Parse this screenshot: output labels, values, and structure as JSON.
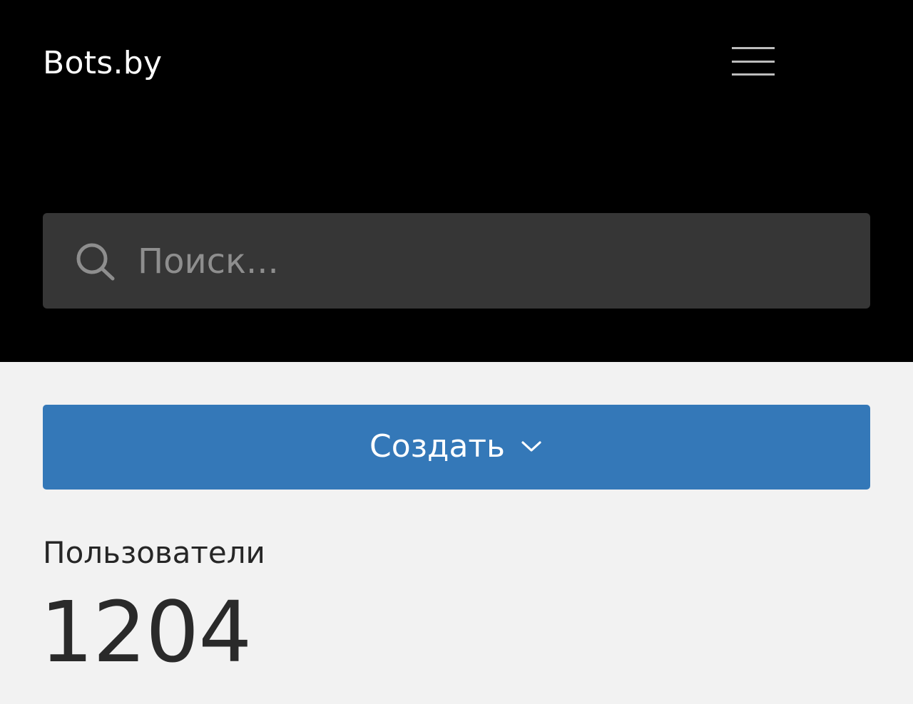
{
  "header": {
    "logo": "Bots.by",
    "menu_icon": "hamburger-icon"
  },
  "search": {
    "placeholder": "Поиск...",
    "icon": "search-icon"
  },
  "create_button": {
    "label": "Создать",
    "icon": "chevron-down-icon"
  },
  "stats": {
    "users_label": "Пользователи",
    "users_count": "1204"
  },
  "colors": {
    "header_bg": "#000000",
    "page_bg": "#f2f2f2",
    "search_bg": "#363636",
    "accent": "#3478b8"
  }
}
